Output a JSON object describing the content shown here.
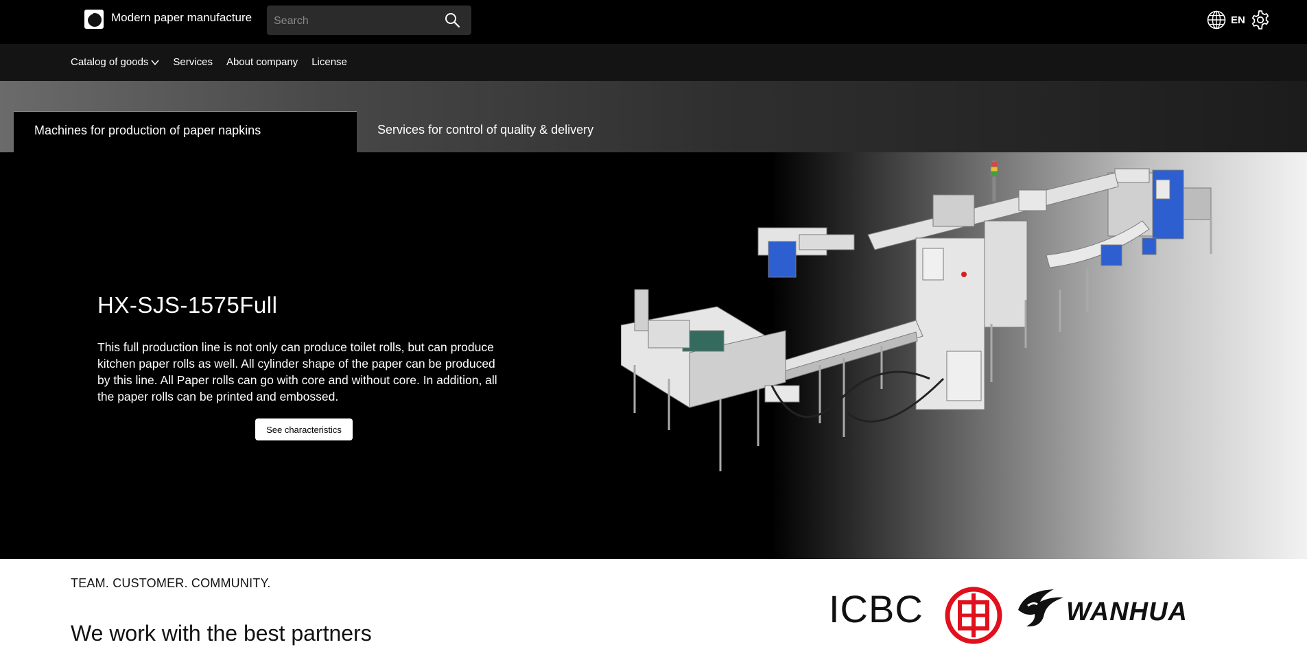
{
  "header": {
    "brand_name": "Modern paper manufacture",
    "search_placeholder": "Search",
    "language": "EN",
    "icons": [
      "brand-logo",
      "search-icon",
      "globe-icon",
      "gear-icon"
    ]
  },
  "nav": {
    "items": [
      {
        "label": "Catalog of goods",
        "dropdown": true
      },
      {
        "label": "Services"
      },
      {
        "label": "About company"
      },
      {
        "label": "License"
      }
    ]
  },
  "tabs": [
    {
      "label": "Machines for production of paper napkins",
      "active": true
    },
    {
      "label": "Services for control of quality & delivery",
      "active": false
    }
  ],
  "hero": {
    "title": "HX-SJS-1575Full",
    "description": "This full production line is not only can produce toilet rolls, but can produce kitchen paper rolls as well. All cylinder shape of the paper can be produced by this line. All Paper rolls can go with core and without core. In addition, all the paper rolls can be printed and embossed.",
    "button_label": "See characteristics"
  },
  "partners": {
    "tagline": "TEAM. CUSTOMER. COMMUNITY.",
    "heading": "We work with the best partners",
    "logos": [
      {
        "name": "ICBC",
        "text": "ICBC"
      },
      {
        "name": "WANHUA",
        "text": "WANHUA"
      }
    ]
  },
  "colors": {
    "topbar_bg": "#000000",
    "navbar_bg": "#141414",
    "icbc_red": "#e0101c",
    "machine_blue": "#2d5fd0"
  }
}
